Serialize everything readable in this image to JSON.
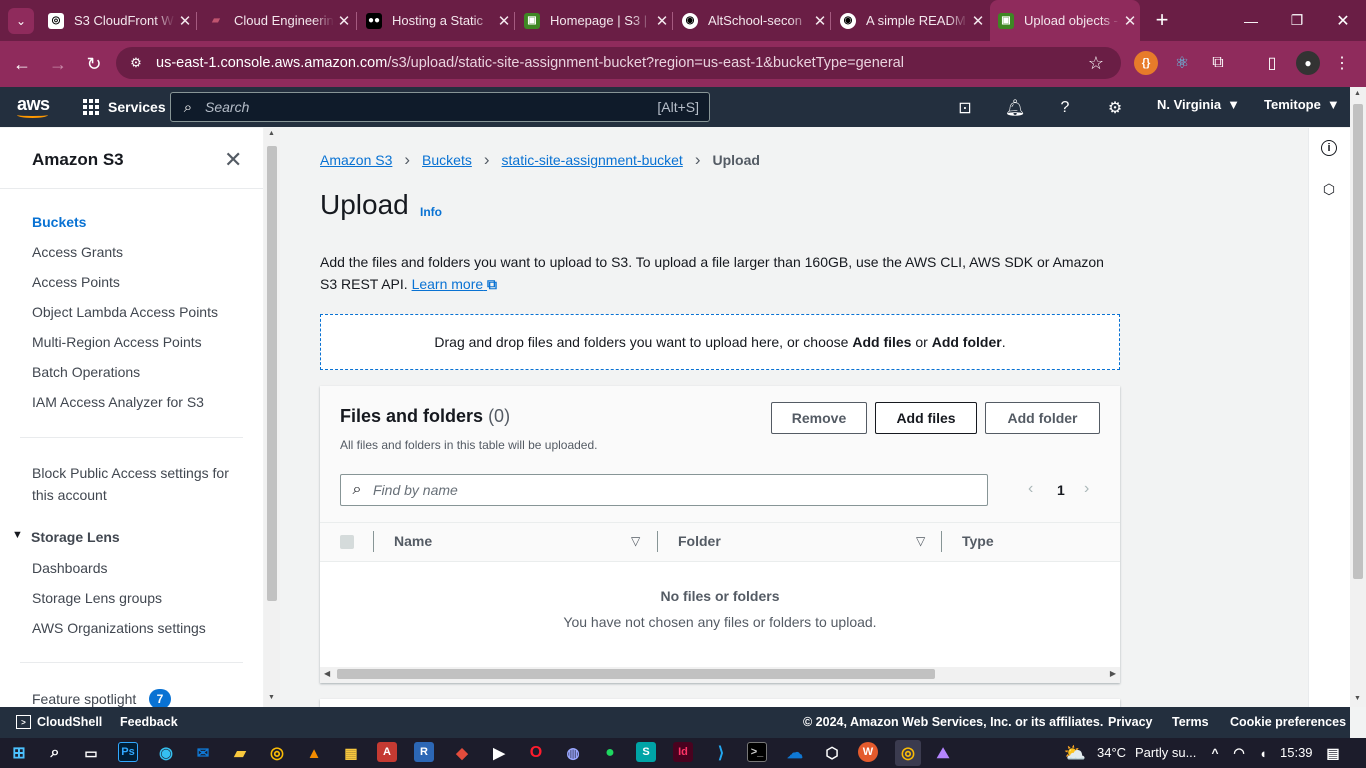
{
  "browser": {
    "tabs": [
      {
        "title": "S3 CloudFront W",
        "icon": "chatgpt-icon"
      },
      {
        "title": "Cloud Engineerin",
        "icon": "altschool-icon"
      },
      {
        "title": "Hosting a Static",
        "icon": "medium-icon"
      },
      {
        "title": "Homepage | S3 |",
        "icon": "aws-s3-icon"
      },
      {
        "title": "AltSchool-secon",
        "icon": "github-icon"
      },
      {
        "title": "A simple READM",
        "icon": "github-icon"
      },
      {
        "title": "Upload objects -",
        "icon": "aws-s3-icon"
      }
    ],
    "url_host": "us-east-1.console.aws.amazon.com",
    "url_path": "/s3/upload/static-site-assignment-bucket?region=us-east-1&bucketType=general"
  },
  "aws_header": {
    "logo": "aws",
    "services": "Services",
    "search_placeholder": "Search",
    "search_shortcut": "[Alt+S]",
    "region": "N. Virginia",
    "user": "Temitope"
  },
  "sidenav": {
    "title": "Amazon S3",
    "items": [
      "Buckets",
      "Access Grants",
      "Access Points",
      "Object Lambda Access Points",
      "Multi-Region Access Points",
      "Batch Operations",
      "IAM Access Analyzer for S3"
    ],
    "block_public": "Block Public Access settings for this account",
    "storage_lens": "Storage Lens",
    "lens_items": [
      "Dashboards",
      "Storage Lens groups",
      "AWS Organizations settings"
    ],
    "feature_spotlight": "Feature spotlight",
    "feature_count": "7"
  },
  "breadcrumb": [
    "Amazon S3",
    "Buckets",
    "static-site-assignment-bucket",
    "Upload"
  ],
  "page": {
    "title": "Upload",
    "info": "Info",
    "description": "Add the files and folders you want to upload to S3. To upload a file larger than 160GB, use the AWS CLI, AWS SDK or Amazon S3 REST API.",
    "learn_more": "Learn more",
    "drop_text": "Drag and drop files and folders you want to upload here, or choose",
    "drop_add_files": "Add files",
    "drop_or": "or",
    "drop_add_folder": "Add folder",
    "drop_end": "."
  },
  "files_panel": {
    "title": "Files and folders",
    "count": "(0)",
    "subtitle": "All files and folders in this table will be uploaded.",
    "remove": "Remove",
    "add_files": "Add files",
    "add_folder": "Add folder",
    "find_placeholder": "Find by name",
    "page": "1",
    "columns": [
      "Name",
      "Folder",
      "Type"
    ],
    "empty_title": "No files or folders",
    "empty_text": "You have not chosen any files or folders to upload."
  },
  "footer": {
    "cloudshell": "CloudShell",
    "feedback": "Feedback",
    "copyright": "© 2024, Amazon Web Services, Inc. or its affiliates.",
    "privacy": "Privacy",
    "terms": "Terms",
    "cookies": "Cookie preferences"
  },
  "taskbar": {
    "weather": "34°C",
    "weather_desc": "Partly su...",
    "time": "15:39"
  }
}
